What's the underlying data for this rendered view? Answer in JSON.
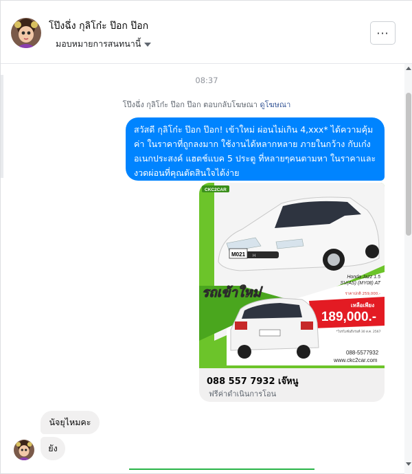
{
  "header": {
    "title": "โป๊งฉึ่ง กุลิโก๋ะ ป๊อก ป๊อก",
    "assign_label": "มอบหมายการสนทนานี้",
    "more_label": "···"
  },
  "conversation": {
    "timestamp": "08:37",
    "notice": {
      "prefix": "โป๊งฉึ่ง กุลิโก๋ะ ป๊อก ป๊อก ตอบกลับโฆษณา",
      "link": "ดูโฆษณา"
    },
    "outgoing_text": "สวัสดี กุลิโก๋ะ ป๊อก ป๊อก! เข้าใหม่ ผ่อนไม่เกิน 4,xxx* ได้ความคุ้มค่า ในราคาที่ถูกลงมาก ใช้งานได้หลากหลาย ภายในกว้าง กับเก๋งอเนกประสงค์ แฮตช์แบค 5 ประตู ที่หลายๆคนตามหา ในราคาและงวดผ่อนที่คุณตัดสินใจได้ง่าย",
    "ad_card": {
      "image": {
        "brand_text": "CKC2CAR",
        "plate": "M021",
        "headline": "รถเข้าใหม่",
        "model": "Honda Jazz 1.5",
        "model_sub": "SV(AS) (MY08) AT",
        "old_price": "ราคาปกติ 259,000.-",
        "price_label": "เหลือเพียง",
        "price": "189,000.-",
        "promo_note": "*โปรโมชั่นถึงวันที่ 30 ส.ค. 2567",
        "phone": "088-5577932",
        "website": "www.ckc2car.com"
      },
      "title": "088 557 7932 เจ๊หนู",
      "subtitle": "ฟรีค่าดำเนินการโอน"
    },
    "incoming": [
      {
        "text": "นัจยุไหมคะ"
      },
      {
        "text": "ยัง"
      }
    ]
  },
  "colors": {
    "messenger_blue": "#0084ff",
    "bubble_gray": "#f1f0f0",
    "ad_green": "#6cc42a",
    "price_red": "#e31b23"
  }
}
